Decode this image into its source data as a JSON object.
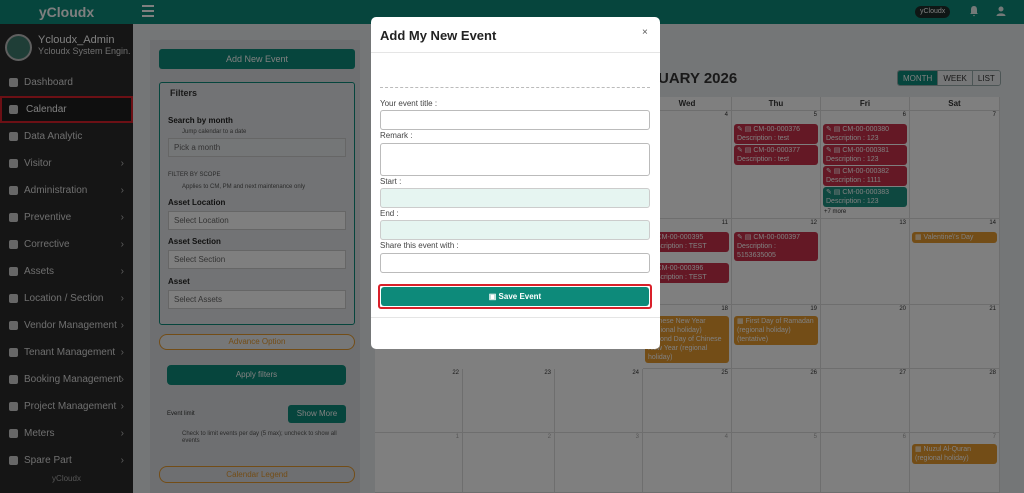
{
  "app": {
    "brand": "yCloudx",
    "user_pill": "yCloudx"
  },
  "profile": {
    "name": "Ycloudx_Admin",
    "role": "Ycloudx System Engin..."
  },
  "sidebar": {
    "items": [
      {
        "label": "Dashboard",
        "has_chevron": false
      },
      {
        "label": "Calendar",
        "has_chevron": false,
        "active": true
      },
      {
        "label": "Data Analytic",
        "has_chevron": false
      },
      {
        "label": "Visitor",
        "has_chevron": true
      },
      {
        "label": "Administration",
        "has_chevron": true
      },
      {
        "label": "Preventive",
        "has_chevron": true
      },
      {
        "label": "Corrective",
        "has_chevron": true
      },
      {
        "label": "Assets",
        "has_chevron": true
      },
      {
        "label": "Location / Section",
        "has_chevron": true
      },
      {
        "label": "Vendor Management",
        "has_chevron": true
      },
      {
        "label": "Tenant Management",
        "has_chevron": true
      },
      {
        "label": "Booking Management",
        "has_chevron": true
      },
      {
        "label": "Project Management",
        "has_chevron": true
      },
      {
        "label": "Meters",
        "has_chevron": true
      },
      {
        "label": "Spare Part",
        "has_chevron": true
      }
    ],
    "footer": "yCloudx"
  },
  "left_panel": {
    "add_event": "Add New Event",
    "filters_title": "Filters",
    "search_by_month": "Search by month",
    "jump_hint": "Jump calendar to a date",
    "month_placeholder": "Pick a month",
    "filter_by_scope": "FILTER BY SCOPE",
    "scope_hint": "Applies to CM, PM and next maintenance only",
    "asset_location": "Asset Location",
    "asset_location_ph": "Select Location",
    "asset_section": "Asset Section",
    "asset_section_ph": "Select Section",
    "asset": "Asset",
    "asset_ph": "Select Assets",
    "advance_option": "Advance Option",
    "apply_filters": "Apply filters",
    "event_limit": "Event limit",
    "show_more": "Show More",
    "limit_note": "Check to limit events per day (5 max); uncheck to show all events",
    "calendar_legend": "Calendar Legend"
  },
  "calendar": {
    "title": "UARY 2026",
    "views": [
      "MONTH",
      "WEEK",
      "LIST"
    ],
    "active_view": "MONTH",
    "day_headers": [
      "Wed",
      "Thu",
      "Fri",
      "Sat"
    ],
    "more_link": "+7 more"
  },
  "modal": {
    "title": "Add My New Event",
    "close": "×",
    "title_label": "Your event title :",
    "remark_label": "Remark :",
    "start_label": "Start :",
    "end_label": "End :",
    "share_label": "Share this event with :",
    "save": "Save Event"
  }
}
